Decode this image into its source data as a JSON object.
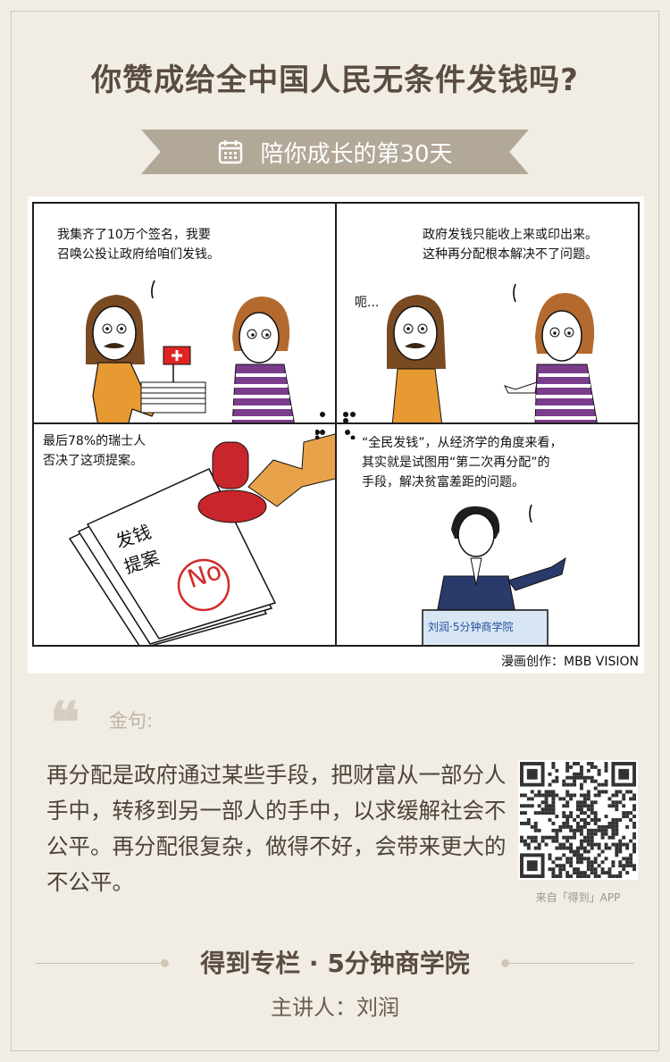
{
  "title": "你赞成给全中国人民无条件发钱吗?",
  "ribbon": {
    "label": "陪你成长的第30天",
    "icon": "calendar-icon"
  },
  "comic": {
    "panel1": {
      "line1": "我集齐了10万个签名，我要",
      "line2": "召唤公投让政府给咱们发钱。"
    },
    "panel2": {
      "line1": "政府发钱只能收上来或印出来。",
      "line2": "这种再分配根本解决不了问题。",
      "reply": "呃..."
    },
    "panel3": {
      "line1": "最后78%的瑞士人",
      "line2": "否决了这项提案。",
      "doc_line1": "发钱",
      "doc_line2": "提案",
      "stamp_text": "No"
    },
    "panel4": {
      "line1": "“全民发钱”，从经济学的角度来看，",
      "line2": "其实就是试图用“第二次再分配”的",
      "line3": "手段，解决贫富差距的问题。",
      "podium": "刘润·5分钟商学院"
    },
    "credit": "漫画创作：MBB VISION"
  },
  "quote": {
    "label": "金句:",
    "text": "再分配是政府通过某些手段，把财富从一部分人手中，转移到另一部人的手中，以求缓解社会不公平。再分配很复杂，做得不好，会带来更大的不公平。"
  },
  "qr": {
    "caption": "来自「得到」APP"
  },
  "footer": {
    "column": "得到专栏 · 5分钟商学院",
    "lecturer": "主讲人：刘润"
  },
  "colors": {
    "background": "#f1ede4",
    "ribbon": "#b2a898",
    "title": "#5a4c40",
    "stamp": "#d22a2a",
    "sweater": "#e89a32",
    "stripes": "#7a3d8c"
  }
}
